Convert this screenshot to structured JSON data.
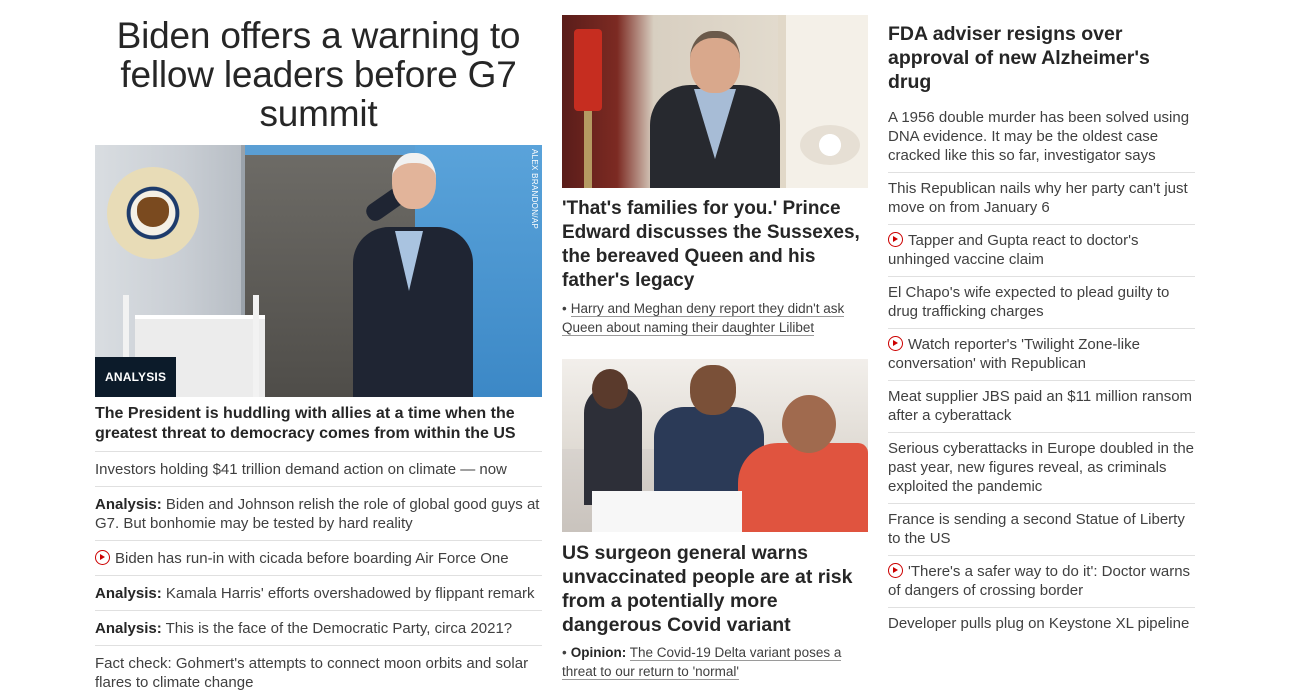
{
  "left": {
    "headline": "Biden offers a warning to fellow leaders before G7 summit",
    "image_credit": "ALEX BRANDON/AP",
    "badge": "ANALYSIS",
    "caption": "The President is huddling with allies at a time when the greatest threat to democracy comes from within the US",
    "items": [
      {
        "prefix": "",
        "text": "Investors holding $41 trillion demand action on climate — now",
        "video": false
      },
      {
        "prefix": "Analysis:",
        "text": " Biden and Johnson relish the role of global good guys at G7. But bonhomie may be tested by hard reality",
        "video": false
      },
      {
        "prefix": "",
        "text": "Biden has run-in with cicada before boarding Air Force One",
        "video": true
      },
      {
        "prefix": "Analysis:",
        "text": " Kamala Harris' efforts overshadowed by flippant remark",
        "video": false
      },
      {
        "prefix": "Analysis:",
        "text": " This is the face of the Democratic Party, circa 2021?",
        "video": false
      },
      {
        "prefix": "",
        "text": "Fact check: Gohmert's attempts to connect moon orbits and solar flares to climate change",
        "video": false
      }
    ]
  },
  "middle": {
    "story1": {
      "headline": "'That's families for you.' Prince Edward discusses the Sussexes, the bereaved Queen and his father's legacy",
      "bullet": "•",
      "sub_link": "Harry and Meghan deny report they didn't ask Queen about naming their daughter Lilibet"
    },
    "story2": {
      "headline": "US surgeon general warns unvaccinated people are at risk from a potentially more dangerous Covid variant",
      "bullet": "•",
      "sub_prefix": "Opinion:",
      "sub_link": "The Covid-19 Delta variant poses a threat to our return to 'normal'"
    }
  },
  "right": {
    "headline": "FDA adviser resigns over approval of new Alzheimer's drug",
    "items": [
      {
        "text": "A 1956 double murder has been solved using DNA evidence. It may be the oldest case cracked like this so far, investigator says",
        "video": false
      },
      {
        "text": "This Republican nails why her party can't just move on from January 6",
        "video": false
      },
      {
        "text": "Tapper and Gupta react to doctor's unhinged vaccine claim",
        "video": true
      },
      {
        "text": "El Chapo's wife expected to plead guilty to drug trafficking charges",
        "video": false
      },
      {
        "text": "Watch reporter's 'Twilight Zone-like conversation' with Republican",
        "video": true
      },
      {
        "text": "Meat supplier JBS paid an $11 million ransom after a cyberattack",
        "video": false
      },
      {
        "text": "Serious cyberattacks in Europe doubled in the past year, new figures reveal, as criminals exploited the pandemic",
        "video": false
      },
      {
        "text": "France is sending a second Statue of Liberty to the US",
        "video": false
      },
      {
        "text": "'There's a safer way to do it': Doctor warns of dangers of crossing border",
        "video": true
      },
      {
        "text": "Developer pulls plug on Keystone XL pipeline",
        "video": false
      }
    ]
  },
  "colors": {
    "video_red": "#cc0000",
    "badge_bg": "#0c1b2a",
    "text": "#262626"
  },
  "icons": {
    "video": "play-circle-icon"
  }
}
